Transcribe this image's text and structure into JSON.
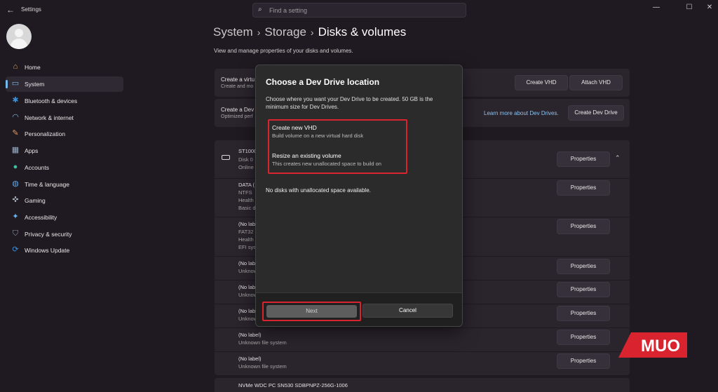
{
  "app": {
    "title": "Settings"
  },
  "search": {
    "placeholder": "Find a setting"
  },
  "window_controls": {
    "minimize": "—",
    "maximize": "☐",
    "close": "✕"
  },
  "sidebar": {
    "items": [
      {
        "label": "Home",
        "icon": "home-icon",
        "color": "#e8a65c"
      },
      {
        "label": "System",
        "icon": "system-icon",
        "color": "#76b9ed",
        "active": true
      },
      {
        "label": "Bluetooth & devices",
        "icon": "bluetooth-icon",
        "color": "#3d8fd6"
      },
      {
        "label": "Network & internet",
        "icon": "wifi-icon",
        "color": "#7fb6e6"
      },
      {
        "label": "Personalization",
        "icon": "brush-icon",
        "color": "#e39a6a"
      },
      {
        "label": "Apps",
        "icon": "apps-icon",
        "color": "#9ab0c8"
      },
      {
        "label": "Accounts",
        "icon": "accounts-icon",
        "color": "#3cc0a0"
      },
      {
        "label": "Time & language",
        "icon": "globe-icon",
        "color": "#5aa6e6"
      },
      {
        "label": "Gaming",
        "icon": "gamepad-icon",
        "color": "#9ea7b3"
      },
      {
        "label": "Accessibility",
        "icon": "accessibility-icon",
        "color": "#6bb2ee"
      },
      {
        "label": "Privacy & security",
        "icon": "shield-icon",
        "color": "#8c96a3"
      },
      {
        "label": "Windows Update",
        "icon": "update-icon",
        "color": "#3a8fe0"
      }
    ]
  },
  "breadcrumb": {
    "part1": "System",
    "part2": "Storage",
    "part3": "Disks & volumes"
  },
  "page": {
    "description": "View and manage properties of your disks and volumes."
  },
  "cards": {
    "vhd": {
      "title": "Create a virtu",
      "subtitle": "Create and mo",
      "create_vhd": "Create VHD",
      "attach_vhd": "Attach VHD"
    },
    "devdrive": {
      "title": "Create a Dev",
      "subtitle": "Optimized perf",
      "learn_more": "Learn more about Dev Drives.",
      "button": "Create Dev Drive"
    }
  },
  "disk": {
    "name": "ST1000",
    "line2": "Disk 0",
    "line3": "Online",
    "properties": "Properties"
  },
  "volumes": [
    {
      "lines": [
        "DATA (",
        "NTFS",
        "Health",
        "Basic d"
      ],
      "properties": "Properties"
    },
    {
      "lines": [
        "(No label",
        "FAT32",
        "Health",
        "EFI syste"
      ],
      "properties": "Properties"
    },
    {
      "lines": [
        "(No label",
        "Unknow"
      ],
      "properties": "Properties"
    },
    {
      "lines": [
        "(No label",
        "Unknow"
      ],
      "properties": "Properties"
    },
    {
      "lines": [
        "(No label",
        "Unknow"
      ],
      "properties": "Properties"
    },
    {
      "lines": [
        "(No label)",
        "Unknown file system"
      ],
      "properties": "Properties"
    },
    {
      "lines": [
        "(No label)",
        "Unknown file system"
      ],
      "properties": "Properties"
    }
  ],
  "disk2": {
    "name": "NVMe WDC PC SN530 SDBPNPZ-256G-1006"
  },
  "dialog": {
    "title": "Choose a Dev Drive location",
    "description": "Choose where you want your Dev Drive to be created. 50 GB is the minimum size for Dev Drives.",
    "options": [
      {
        "title": "Create new VHD",
        "subtitle": "Build volume on a new virtual hard disk"
      },
      {
        "title": "Resize an existing volume",
        "subtitle": "This creates new unallocated space to build on"
      }
    ],
    "note": "No disks with unallocated space available.",
    "next": "Next",
    "cancel": "Cancel"
  },
  "watermark": {
    "text": "MUO"
  },
  "colors": {
    "accent": "#76b9ed",
    "highlight_border": "#d9232f",
    "background": "#1f1a21",
    "card": "#2a242d"
  }
}
